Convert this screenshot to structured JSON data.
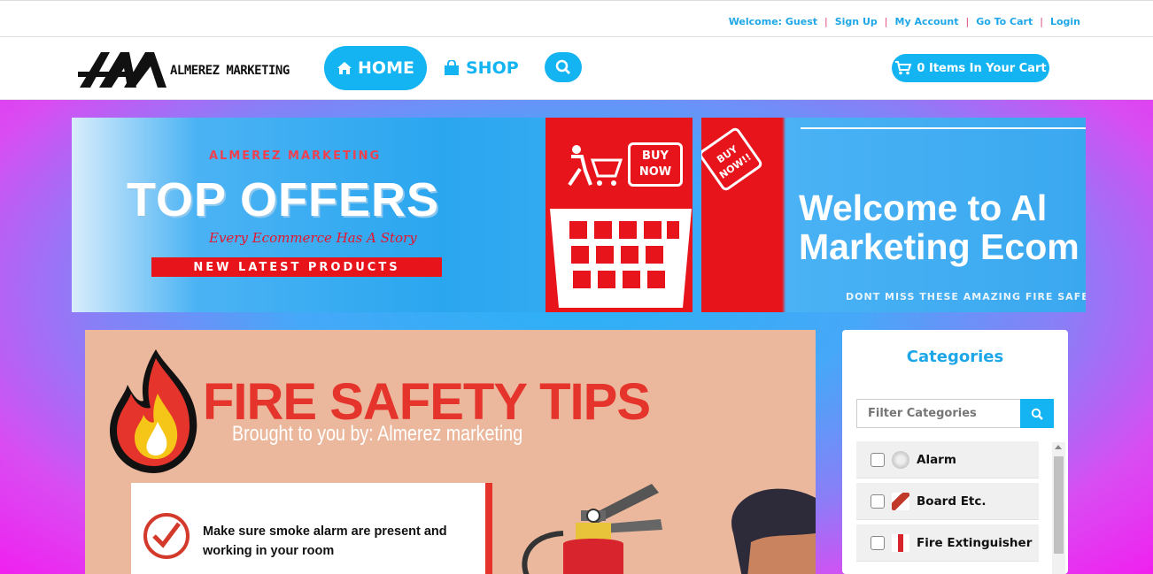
{
  "topbar": {
    "welcome": "Welcome: Guest",
    "signup": "Sign Up",
    "account": "My Account",
    "cart_link": "Go To Cart",
    "login": "Login",
    "sep": "|"
  },
  "nav": {
    "logo_text": "ALMEREZ MARKETING",
    "home": "HOME",
    "shop": "SHOP",
    "cart": "0 Items In Your Cart"
  },
  "banner1": {
    "brand": "ALMEREZ MARKETING",
    "headline": "TOP OFFERS",
    "slogan": "Every Ecommerce Has A Story",
    "ribbon": "NEW LATEST PRODUCTS",
    "buy_now": "BUY NOW"
  },
  "banner2": {
    "buy_now": "BUY NOW!!",
    "welcome_line1": "Welcome to Al",
    "welcome_line2": "Marketing Ecom",
    "tagline": "DONT MISS THESE AMAZING  FIRE SAFE"
  },
  "poster": {
    "title": "FIRE SAFETY TIPS",
    "subtitle": "Brought to you by: Almerez marketing",
    "tip1": "Make sure smoke alarm are present and working in your room"
  },
  "sidebar": {
    "title": "Categories",
    "filter_placeholder": "Filter Categories",
    "categories": [
      {
        "label": "Alarm"
      },
      {
        "label": "Board Etc."
      },
      {
        "label": "Fire Extinguisher"
      }
    ]
  },
  "colors": {
    "accent": "#14b4f2",
    "link_sep": "#e0407a",
    "poster_bg": "#ebb89d",
    "fire_red": "#e4342c"
  }
}
